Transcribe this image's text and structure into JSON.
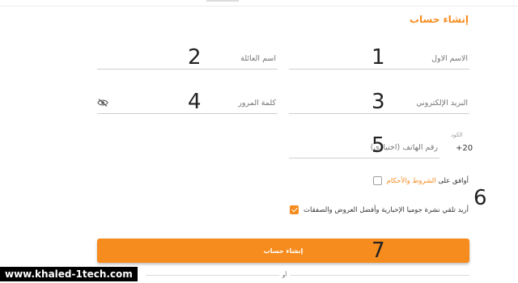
{
  "form": {
    "title": "إنشاء حساب",
    "fields": {
      "first_name": {
        "label": "الاسم الاول",
        "number": "1"
      },
      "last_name": {
        "label": "اسم العائلة",
        "number": "2"
      },
      "email": {
        "label": "البريد الإلكتروني",
        "number": "3"
      },
      "password": {
        "label": "كلمة المرور",
        "number": "4",
        "toggle_icon": "eye-off-icon"
      },
      "phone": {
        "label": "رقم الهاتف (اختياري)",
        "number": "5",
        "code_label": "الكود",
        "code_value": "+20"
      }
    },
    "checkboxes": {
      "terms": {
        "prefix": "أوافق على ",
        "link": "الشروط والأحكام",
        "checked": false
      },
      "newsletter": {
        "text": "أريد تلقي نشرة جوميا الإخبارية وأفضل العروض والصفقات",
        "checked": true,
        "number": "6"
      }
    },
    "submit": {
      "label": "إنشاء حساب",
      "number": "7"
    },
    "divider_text": "أو"
  },
  "watermark": "www.khaled-1tech.com",
  "colors": {
    "accent": "#f68b1e",
    "border": "#cfcfcf"
  }
}
